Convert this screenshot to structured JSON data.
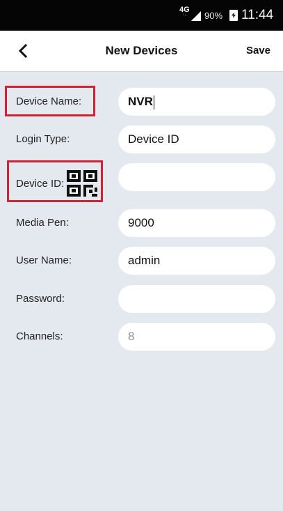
{
  "status_bar": {
    "network": "4G",
    "battery_percent": "90%",
    "time": "11:44"
  },
  "header": {
    "back_icon": "chevron-left-icon",
    "title": "New Devices",
    "save_label": "Save"
  },
  "form": {
    "device_name": {
      "label": "Device Name:",
      "value": "NVR"
    },
    "login_type": {
      "label": "Login Type:",
      "value": "Device ID"
    },
    "device_id": {
      "label": "Device ID:",
      "value": "",
      "icon": "qr-code-icon"
    },
    "media_port": {
      "label": "Media Pen:",
      "value": "9000"
    },
    "user_name": {
      "label": "User Name:",
      "value": "admin"
    },
    "password": {
      "label": "Password:",
      "value": ""
    },
    "channels": {
      "label": "Channels:",
      "value": "8"
    }
  },
  "colors": {
    "highlight": "#d42232",
    "background": "#e4e8ef",
    "status_bar": "#050505"
  }
}
